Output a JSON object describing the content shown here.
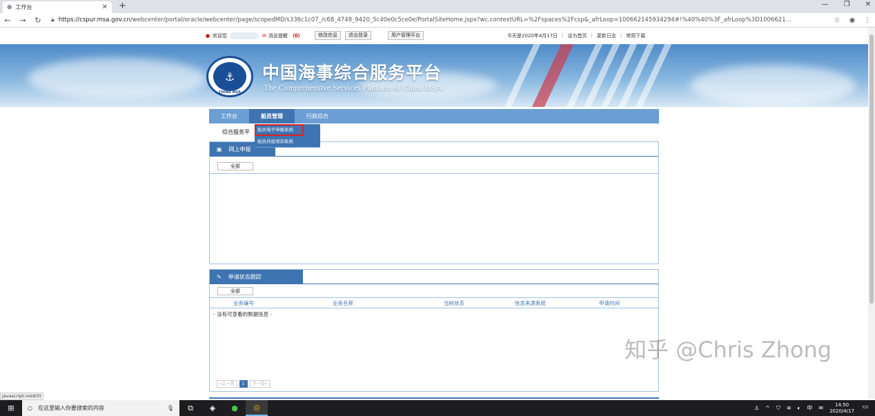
{
  "browser": {
    "tab_title": "工作台",
    "tab_close": "✕",
    "new_tab": "+",
    "url_host": "https://cspur.msa.gov.cn",
    "url_path": "/webcenter/portal/oracle/webcenter/page/scopedMD/s336c1c07_/c68_4748_9420_5c40e0c5ce0e/PortalSiteHome.jspx?wc.contextURL=%2Fspaces%2Fcsp&_afrLoop=100662145934294#!%40%40%3F_afrLoop%3D1006621...",
    "status_url": "javascript:void(0)"
  },
  "topbar": {
    "welcome": "欢迎您",
    "messages_label": "消息提醒",
    "messages_count": "（0）",
    "edit_info": "修改信息",
    "logout": "退出登录",
    "user_platform": "用户管理平台",
    "today": "今天是2020年4月17日",
    "set_home": "设为首页",
    "update_log": "更新日志",
    "downloads": "常用下载"
  },
  "banner": {
    "title": "中国海事综合服务平台",
    "subtitle": "The Comprehensive Services Platform of China MSA",
    "emblem_top": "中国海事局",
    "emblem_bottom": "CHINA MSA"
  },
  "nav": {
    "items": [
      "工作台",
      "船员管理",
      "行政综合"
    ],
    "active_index": 1,
    "breadcrumb": "综合服务平"
  },
  "dropdown": {
    "options": [
      "船员电子申报系统",
      "船员兵役培训系统"
    ]
  },
  "panel_online": {
    "title": "网上申报",
    "filter": "全部"
  },
  "panel_status": {
    "title": "申请状态跟踪",
    "filter": "全部",
    "columns": [
      "业务编号",
      "业务名称",
      "当前状态",
      "信息来源系统",
      "申请时间"
    ],
    "empty_message": "- 没有可查看的数据信息 -",
    "pager": {
      "prev": "«上一页",
      "current": "1",
      "next": "下一页»"
    }
  },
  "watermark": "知乎 @Chris Zhong",
  "taskbar": {
    "search_placeholder": "在这里输入你要搜索的内容",
    "time": "14:50",
    "date": "2020/4/17"
  }
}
